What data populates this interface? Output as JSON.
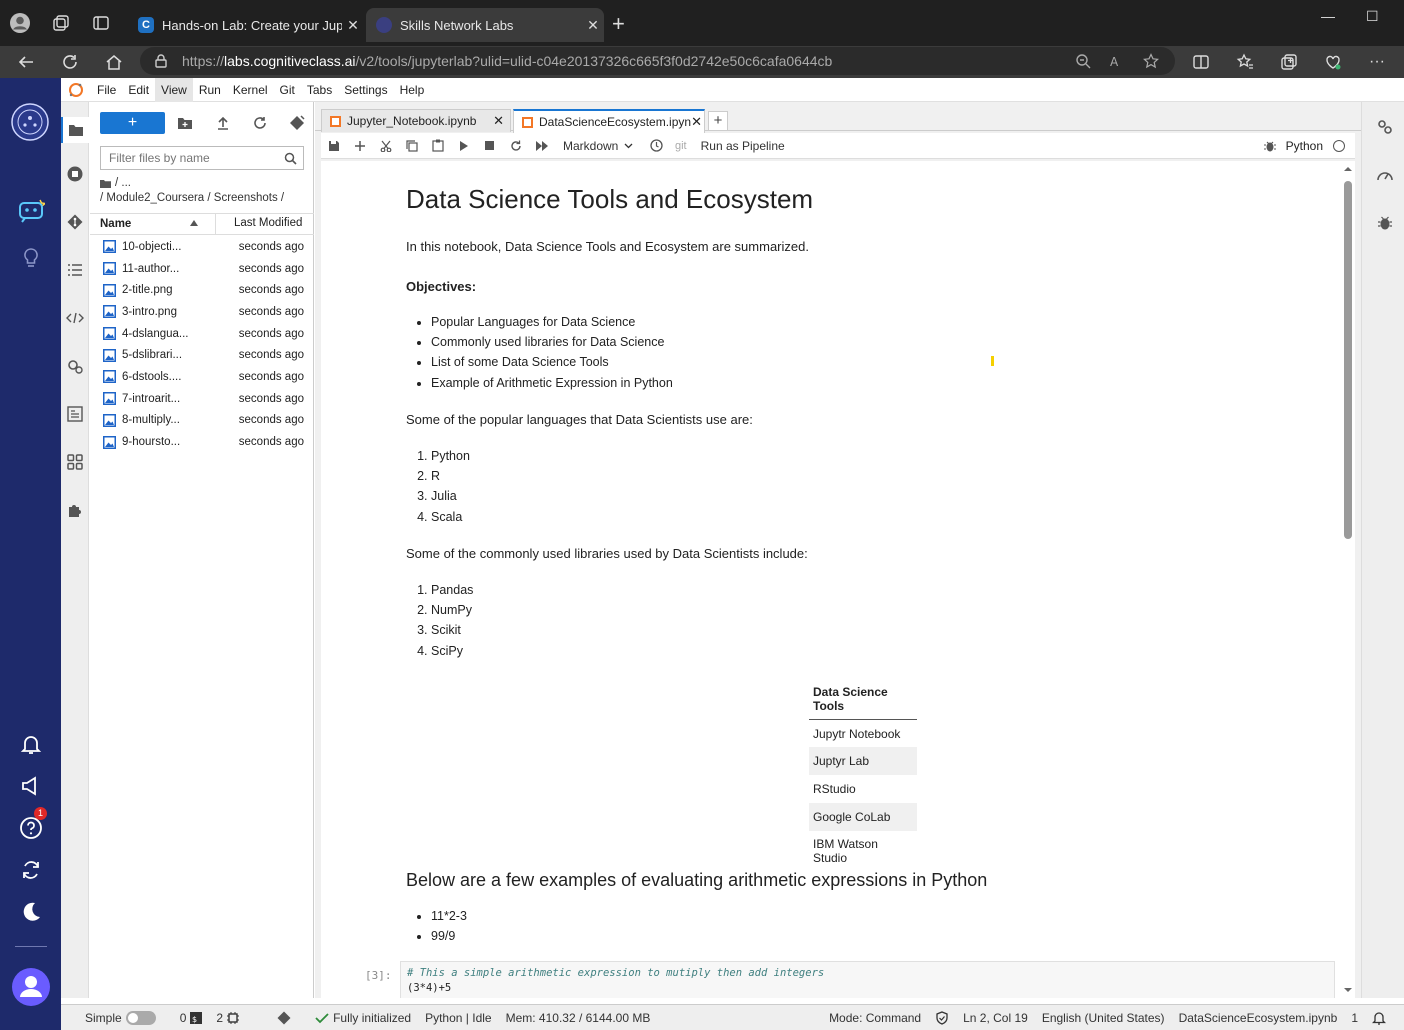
{
  "browser": {
    "tabs": [
      {
        "title": "Hands-on Lab: Create your Jupyt",
        "active": false
      },
      {
        "title": "Skills Network Labs",
        "active": true
      }
    ],
    "url_prefix": "https://",
    "url_host": "labs.cognitiveclass.ai",
    "url_path": "/v2/tools/jupyterlab?ulid=ulid-c04e20137326c665f3f0d2742e50c6cafa0644cb"
  },
  "rail": {
    "notification_count": "1"
  },
  "menu": [
    "File",
    "Edit",
    "View",
    "Run",
    "Kernel",
    "Git",
    "Tabs",
    "Settings",
    "Help"
  ],
  "filebrowser": {
    "new_label": "+",
    "filter_placeholder": "Filter files by name",
    "breadcrumb_top": "/ ...",
    "breadcrumb_path": "/ Module2_Coursera / Screenshots /",
    "col_name": "Name",
    "col_modified": "Last Modified",
    "files": [
      {
        "name": "10-objecti...",
        "modified": "seconds ago"
      },
      {
        "name": "11-author...",
        "modified": "seconds ago"
      },
      {
        "name": "2-title.png",
        "modified": "seconds ago"
      },
      {
        "name": "3-intro.png",
        "modified": "seconds ago"
      },
      {
        "name": "4-dslangua...",
        "modified": "seconds ago"
      },
      {
        "name": "5-dslibrari...",
        "modified": "seconds ago"
      },
      {
        "name": "6-dstools....",
        "modified": "seconds ago"
      },
      {
        "name": "7-introarit...",
        "modified": "seconds ago"
      },
      {
        "name": "8-multiply...",
        "modified": "seconds ago"
      },
      {
        "name": "9-hoursto...",
        "modified": "seconds ago"
      }
    ]
  },
  "doc_tabs": [
    {
      "title": "Jupyter_Notebook.ipynb"
    },
    {
      "title": "DataScienceEcosystem.ipyn"
    }
  ],
  "toolbar": {
    "cell_type": "Markdown",
    "git_label": "git",
    "pipeline_label": "Run as Pipeline",
    "kernel": "Python"
  },
  "notebook": {
    "title": "Data Science Tools and Ecosystem",
    "intro": "In this notebook, Data Science Tools and Ecosystem are summarized.",
    "objectives_label": "Objectives:",
    "objectives": [
      "Popular Languages for Data Science",
      "Commonly used libraries for Data Science",
      "List of some Data Science Tools",
      "Example of Arithmetic Expression in Python"
    ],
    "languages_intro": "Some of the popular languages that Data Scientists use are:",
    "languages": [
      "Python",
      "R",
      "Julia",
      "Scala"
    ],
    "libraries_intro": "Some of the commonly used libraries used by Data Scientists include:",
    "libraries": [
      "Pandas",
      "NumPy",
      "Scikit",
      "SciPy"
    ],
    "tools_header": "Data Science Tools",
    "tools": [
      "Jupytr Notebook",
      "Juptyr Lab",
      "RStudio",
      "Google CoLab",
      "IBM Watson Studio"
    ],
    "examples_heading": "Below are a few examples of evaluating arithmetic expressions in Python",
    "examples": [
      "11*2-3",
      "99/9"
    ],
    "code_prompt": "[3]:",
    "code_comment": "#  This a simple arithmetic expression to mutiply then add integers",
    "code_line": "(3*4)+5"
  },
  "statusbar": {
    "mode_toggle": "Simple",
    "terminals": "0",
    "kernels": "2",
    "git_status": "Fully initialized",
    "kernel_status": "Python | Idle",
    "memory": "Mem: 410.32 / 6144.00 MB",
    "mode": "Mode: Command",
    "position": "Ln 2, Col 19",
    "language": "English (United States)",
    "filename": "DataScienceEcosystem.ipynb",
    "tail": "1"
  },
  "colors": {
    "accent": "#1976d2",
    "rail": "#1e2a6b"
  }
}
